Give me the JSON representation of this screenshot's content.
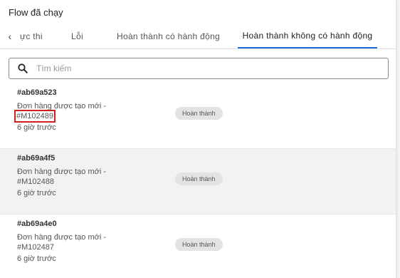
{
  "header": {
    "title": "Flow đã chạy"
  },
  "tabs": [
    {
      "label": "ực thi"
    },
    {
      "label": "Lỗi"
    },
    {
      "label": "Hoàn thành có hành động"
    },
    {
      "label": "Hoàn thành không có hành động",
      "active": true
    }
  ],
  "tab_prev_icon": "chevron-left-icon",
  "search": {
    "placeholder": "Tìm kiếm",
    "value": "",
    "icon": "search-icon"
  },
  "items": [
    {
      "id": "#ab69a523",
      "desc": "Đơn hàng được tạo mới -",
      "order": "#M102489",
      "time": "6 giờ trước",
      "status": "Hoàn thành"
    },
    {
      "id": "#ab69a4f5",
      "desc": "Đơn hàng được tạo mới -",
      "order": "#M102488",
      "time": "6 giờ trước",
      "status": "Hoàn thành"
    },
    {
      "id": "#ab69a4e0",
      "desc": "Đơn hàng được tạo mới -",
      "order": "#M102487",
      "time": "6 giờ trước",
      "status": "Hoàn thành"
    }
  ],
  "colors": {
    "active_tab_underline": "#1e6fd9",
    "highlight_box": "#d01f1f",
    "badge_bg": "#e3e3e3"
  }
}
